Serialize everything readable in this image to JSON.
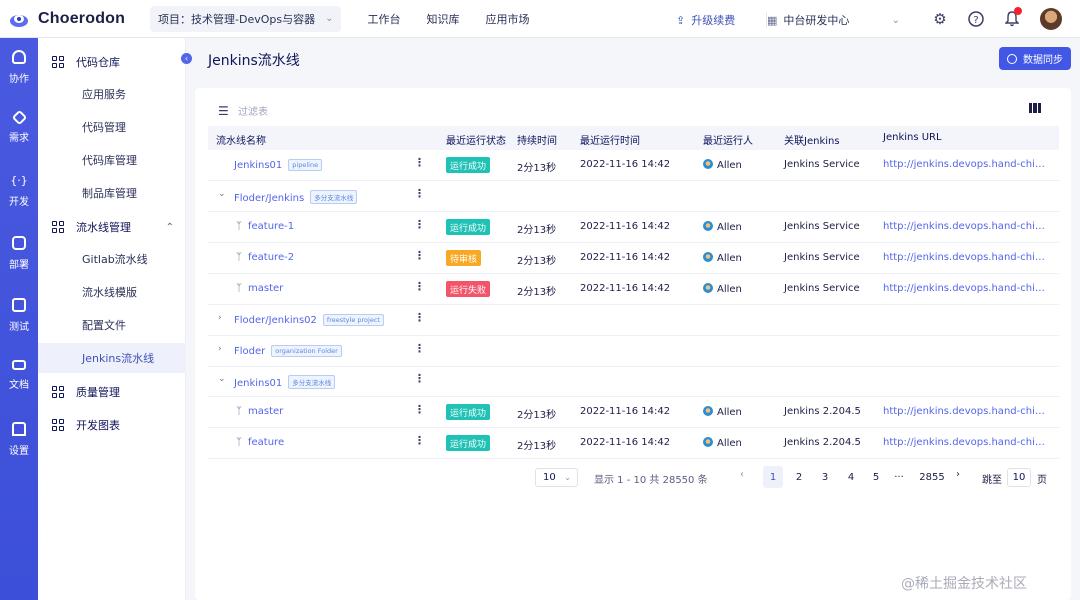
{
  "app": {
    "name": "Choerodon"
  },
  "header": {
    "project_label": "项目：技术管理-DevOps与容器",
    "nav": [
      "工作台",
      "知识库",
      "应用市场"
    ],
    "upgrade_label": "升级续费",
    "org_label": "中台研发中心"
  },
  "leftbar": {
    "items": [
      "协作",
      "需求",
      "开发",
      "部署",
      "测试",
      "文档",
      "设置"
    ]
  },
  "submenu": {
    "groups": [
      {
        "label": "代码仓库",
        "items": [
          "应用服务",
          "代码管理",
          "代码库管理",
          "制品库管理"
        ]
      },
      {
        "label": "流水线管理",
        "items": [
          "Gitlab流水线",
          "流水线模版",
          "配置文件",
          "Jenkins流水线"
        ]
      },
      {
        "label": "质量管理"
      },
      {
        "label": "开发图表"
      }
    ],
    "active_item": "Jenkins流水线"
  },
  "page": {
    "title": "Jenkins流水线",
    "sync_label": "数据同步",
    "filter_placeholder": "过滤表"
  },
  "table": {
    "columns": [
      "流水线名称",
      "最近运行状态",
      "持续时间",
      "最近运行时间",
      "最近运行人",
      "关联Jenkins",
      "Jenkins URL"
    ],
    "rows": [
      {
        "name": "Jenkins01",
        "tag": "pipeline",
        "status": "运行成功",
        "duration": "2分13秒",
        "time": "2022-11-16 14:42",
        "runner": "Allen",
        "jenkins": "Jenkins Service",
        "url": "http://jenkins.devops.hand-china.com"
      },
      {
        "name": "Floder/Jenkins",
        "tag": "多分支流水线"
      },
      {
        "name": "feature-1",
        "status": "运行成功",
        "duration": "2分13秒",
        "time": "2022-11-16 14:42",
        "runner": "Allen",
        "jenkins": "Jenkins Service",
        "url": "http://jenkins.devops.hand-china.com"
      },
      {
        "name": "feature-2",
        "status": "待审核",
        "duration": "2分13秒",
        "time": "2022-11-16 14:42",
        "runner": "Allen",
        "jenkins": "Jenkins Service",
        "url": "http://jenkins.devops.hand-china.com"
      },
      {
        "name": "master",
        "status": "运行失败",
        "duration": "2分13秒",
        "time": "2022-11-16 14:42",
        "runner": "Allen",
        "jenkins": "Jenkins Service",
        "url": "http://jenkins.devops.hand-china.com"
      },
      {
        "name": "Floder/Jenkins02",
        "tag": "freestyle project"
      },
      {
        "name": "Floder",
        "tag": "organization Folder"
      },
      {
        "name": "Jenkins01",
        "tag": "多分支流水线"
      },
      {
        "name": "master",
        "status": "运行成功",
        "duration": "2分13秒",
        "time": "2022-11-16 14:42",
        "runner": "Allen",
        "jenkins": "Jenkins 2.204.5",
        "url": "http://jenkins.devops.hand-china.com"
      },
      {
        "name": "feature",
        "status": "运行成功",
        "duration": "2分13秒",
        "time": "2022-11-16 14:42",
        "runner": "Allen",
        "jenkins": "Jenkins 2.204.5",
        "url": "http://jenkins.devops.hand-china.com"
      }
    ]
  },
  "pagination": {
    "page_size": "10",
    "info": "显示 1 - 10 共 28550 条",
    "pages": [
      "1",
      "2",
      "3",
      "4",
      "5",
      "···",
      "2855"
    ],
    "current": "1",
    "jump_label": "跳至",
    "jump_value": "10",
    "page_suffix": "页"
  },
  "footer": {
    "mark": "@稀土掘金技术社区"
  },
  "colors": {
    "primary": "#4257e6",
    "success": "#1fc2b5",
    "pending": "#f9a825",
    "failed": "#f2546a"
  }
}
